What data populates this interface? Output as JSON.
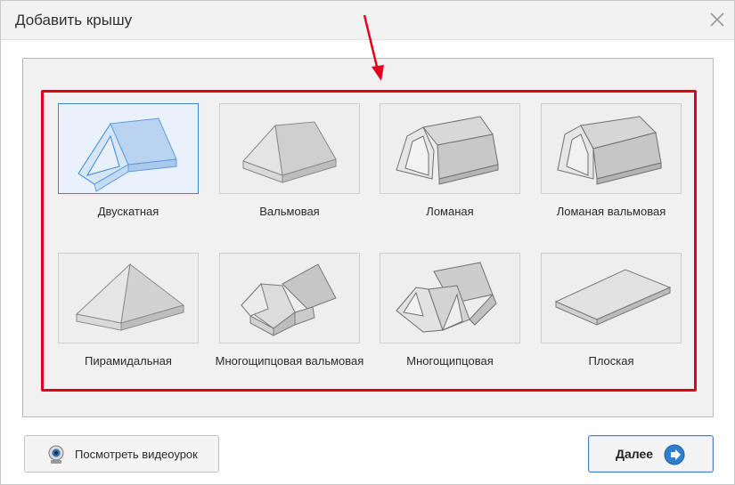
{
  "dialog": {
    "title": "Добавить крышу"
  },
  "roof_types": [
    {
      "label": "Двускатная",
      "icon": "gable-roof-icon",
      "selected": true
    },
    {
      "label": "Вальмовая",
      "icon": "hip-roof-icon",
      "selected": false
    },
    {
      "label": "Ломаная",
      "icon": "gambrel-roof-icon",
      "selected": false
    },
    {
      "label": "Ломаная вальмовая",
      "icon": "hip-gambrel-roof-icon",
      "selected": false
    },
    {
      "label": "Пирамидальная",
      "icon": "pyramid-roof-icon",
      "selected": false
    },
    {
      "label": "Многощипцовая вальмовая",
      "icon": "multi-gable-hip-roof-icon",
      "selected": false
    },
    {
      "label": "Многощипцовая",
      "icon": "multi-gable-roof-icon",
      "selected": false
    },
    {
      "label": "Плоская",
      "icon": "flat-roof-icon",
      "selected": false
    }
  ],
  "buttons": {
    "video_label": "Посмотреть видеоурок",
    "next_label": "Далее"
  },
  "colors": {
    "highlight": "#e3001b",
    "selected_border": "#3b86d6",
    "selected_fill": "#b9d3f1",
    "roof_gray": "#cfcfcf"
  }
}
